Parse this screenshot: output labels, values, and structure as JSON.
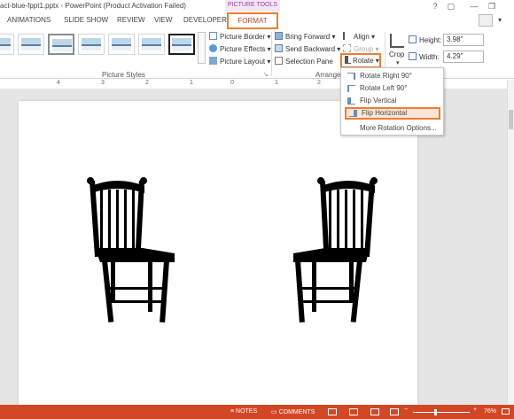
{
  "window": {
    "title": "act-blue-fppt1.pptx - PowerPoint (Product Activation Failed)",
    "context_header": "PICTURE TOOLS",
    "buttons": [
      "?",
      "▢",
      "—",
      "❐"
    ]
  },
  "tabs": [
    "ANIMATIONS",
    "SLIDE SHOW",
    "REVIEW",
    "VIEW",
    "DEVELOPER"
  ],
  "active_tab": "FORMAT",
  "ribbon": {
    "picture_styles_label": "Picture Styles",
    "picture_border": "Picture Border",
    "picture_effects": "Picture Effects",
    "picture_layout": "Picture Layout",
    "bring_forward": "Bring Forward",
    "send_backward": "Send Backward",
    "selection_pane": "Selection Pane",
    "align": "Align",
    "group": "Group",
    "rotate": "Rotate",
    "arrange_label": "Arrange",
    "crop": "Crop",
    "height_label": "Height:",
    "height_value": "3.98\"",
    "width_label": "Width:",
    "width_value": "4.29\""
  },
  "ruler_numbers": [
    "4",
    "3",
    "2",
    "1",
    "0",
    "1",
    "2",
    "3",
    "4"
  ],
  "rotate_menu": {
    "items": [
      "Rotate Right 90°",
      "Rotate Left 90°",
      "Flip Vertical",
      "Flip Horizontal",
      "More Rotation Options..."
    ]
  },
  "statusbar": {
    "notes": "NOTES",
    "comments": "COMMENTS",
    "zoom": "76%"
  },
  "colors": {
    "accent": "#ed7d31",
    "statusbar": "#d24726",
    "context_tab": "#9b3fa0"
  }
}
